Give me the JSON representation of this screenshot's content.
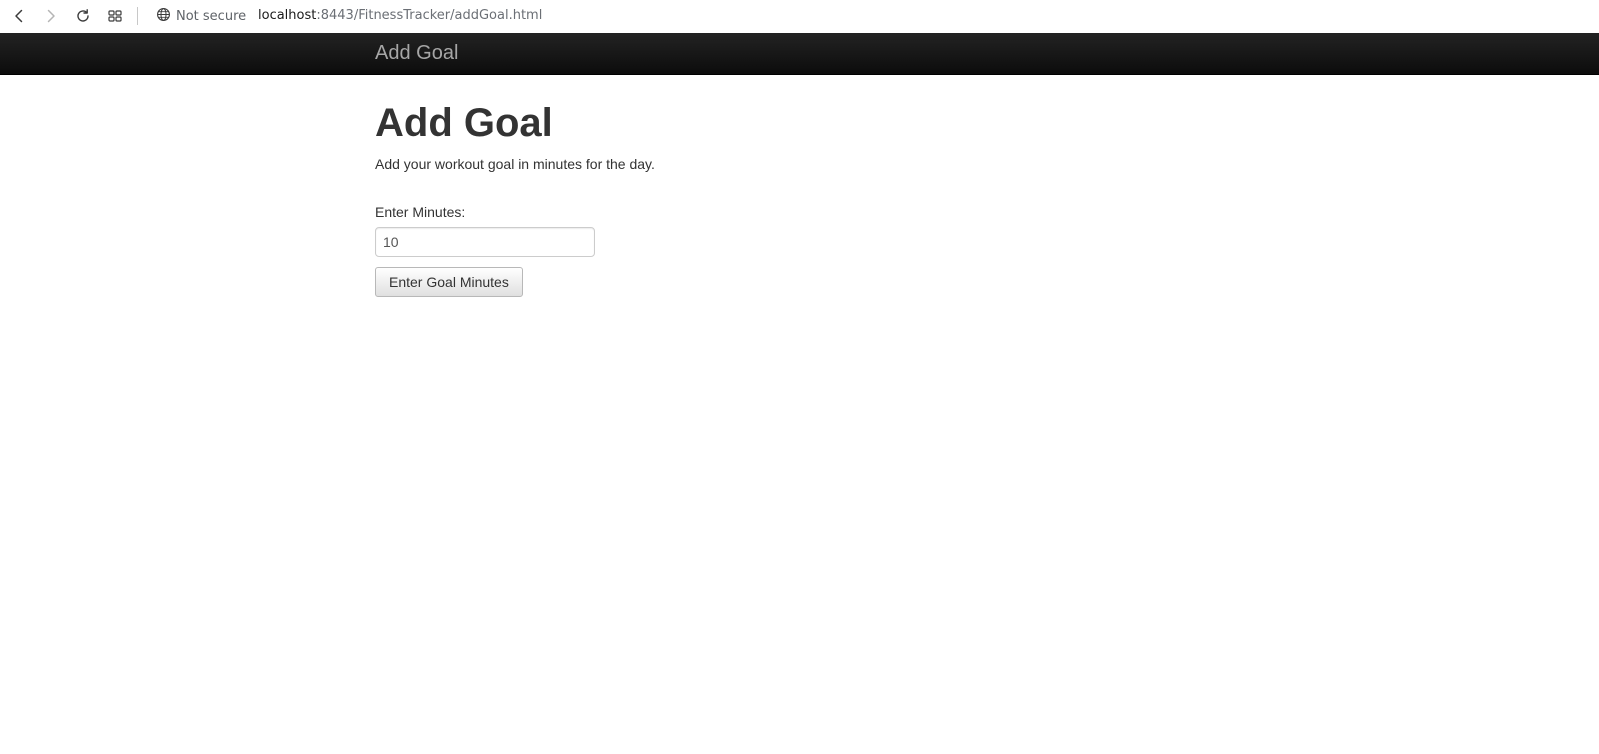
{
  "browser": {
    "security_label": "Not secure",
    "url_host": "localhost",
    "url_path": ":8443/FitnessTracker/addGoal.html",
    "icons": {
      "back": "back-arrow-icon",
      "forward": "forward-arrow-icon",
      "reload": "reload-icon",
      "tabs": "tab-grid-icon",
      "security": "globe-icon"
    }
  },
  "navbar": {
    "brand": "Add Goal"
  },
  "main": {
    "title": "Add Goal",
    "subtitle": "Add your workout goal in minutes for the day.",
    "form": {
      "minutes_label": "Enter Minutes:",
      "minutes_value": "10",
      "submit_label": "Enter Goal Minutes"
    }
  },
  "colors": {
    "navbar_bg": "#1b1b1b",
    "navbar_brand": "#a6a6a6",
    "text": "#333333"
  }
}
